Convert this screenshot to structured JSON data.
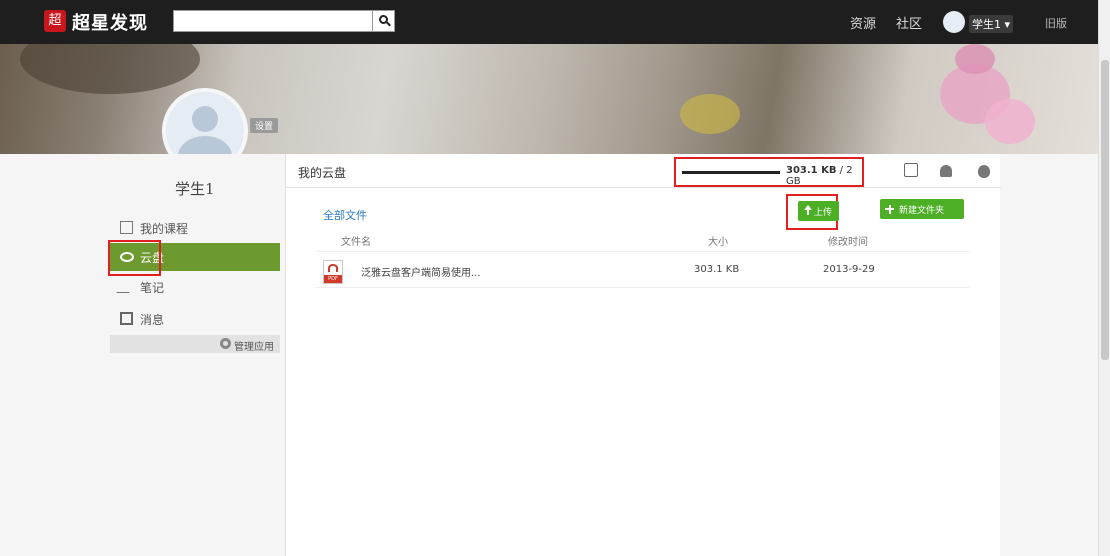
{
  "navbar": {
    "logo_glyph": "超",
    "logo_text": "超星发现",
    "search": {
      "value": "",
      "placeholder": ""
    },
    "links": [
      "资源",
      "社区"
    ],
    "user_label": "学生1",
    "old_version": "旧版"
  },
  "profile": {
    "settings_tag": "设置",
    "username": "学生1"
  },
  "sidebar": {
    "items": [
      {
        "label": "我的课程",
        "icon": "course-icon"
      },
      {
        "label": "云盘",
        "icon": "cloud-icon"
      },
      {
        "label": "笔记",
        "icon": "pen-icon"
      },
      {
        "label": "消息",
        "icon": "message-icon"
      }
    ],
    "manage_label": "管理应用"
  },
  "panel": {
    "title": "我的云盘",
    "quota_used": "303.1 KB",
    "quota_total": " / 2 GB",
    "all_files": "全部文件",
    "upload_label": "上传",
    "new_folder_label": "新建文件夹",
    "columns": {
      "name": "文件名",
      "size": "大小",
      "modified": "修改时间"
    },
    "files": [
      {
        "name": "泛雅云盘客户端简易使用...",
        "size": "303.1 KB",
        "modified": "2013-9-29",
        "type": "PDF"
      }
    ]
  },
  "colors": {
    "accent_green": "#6d9a2e",
    "button_green": "#4caf26",
    "highlight_red": "#e02020",
    "link_blue": "#2a7ac7"
  }
}
